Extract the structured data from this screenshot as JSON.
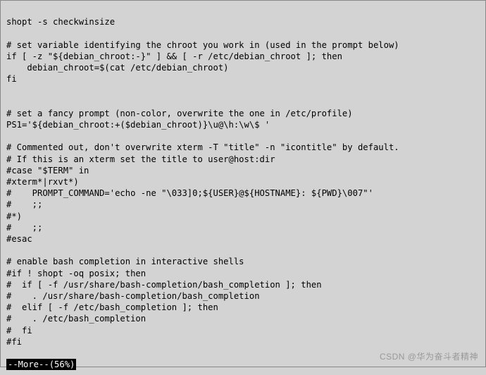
{
  "terminal": {
    "lines": [
      "shopt -s checkwinsize",
      "",
      "# set variable identifying the chroot you work in (used in the prompt below)",
      "if [ -z \"${debian_chroot:-}\" ] && [ -r /etc/debian_chroot ]; then",
      "    debian_chroot=$(cat /etc/debian_chroot)",
      "fi",
      "",
      "",
      "# set a fancy prompt (non-color, overwrite the one in /etc/profile)",
      "PS1='${debian_chroot:+($debian_chroot)}\\u@\\h:\\w\\$ '",
      "",
      "# Commented out, don't overwrite xterm -T \"title\" -n \"icontitle\" by default.",
      "# If this is an xterm set the title to user@host:dir",
      "#case \"$TERM\" in",
      "#xterm*|rxvt*)",
      "#    PROMPT_COMMAND='echo -ne \"\\033]0;${USER}@${HOSTNAME}: ${PWD}\\007\"'",
      "#    ;;",
      "#*)",
      "#    ;;",
      "#esac",
      "",
      "# enable bash completion in interactive shells",
      "#if ! shopt -oq posix; then",
      "#  if [ -f /usr/share/bash-completion/bash_completion ]; then",
      "#    . /usr/share/bash-completion/bash_completion",
      "#  elif [ -f /etc/bash_completion ]; then",
      "#    . /etc/bash_completion",
      "#  fi",
      "#fi",
      ""
    ],
    "pager_status": "--More--(56%)"
  },
  "watermark": "CSDN @华为奋斗者精神"
}
